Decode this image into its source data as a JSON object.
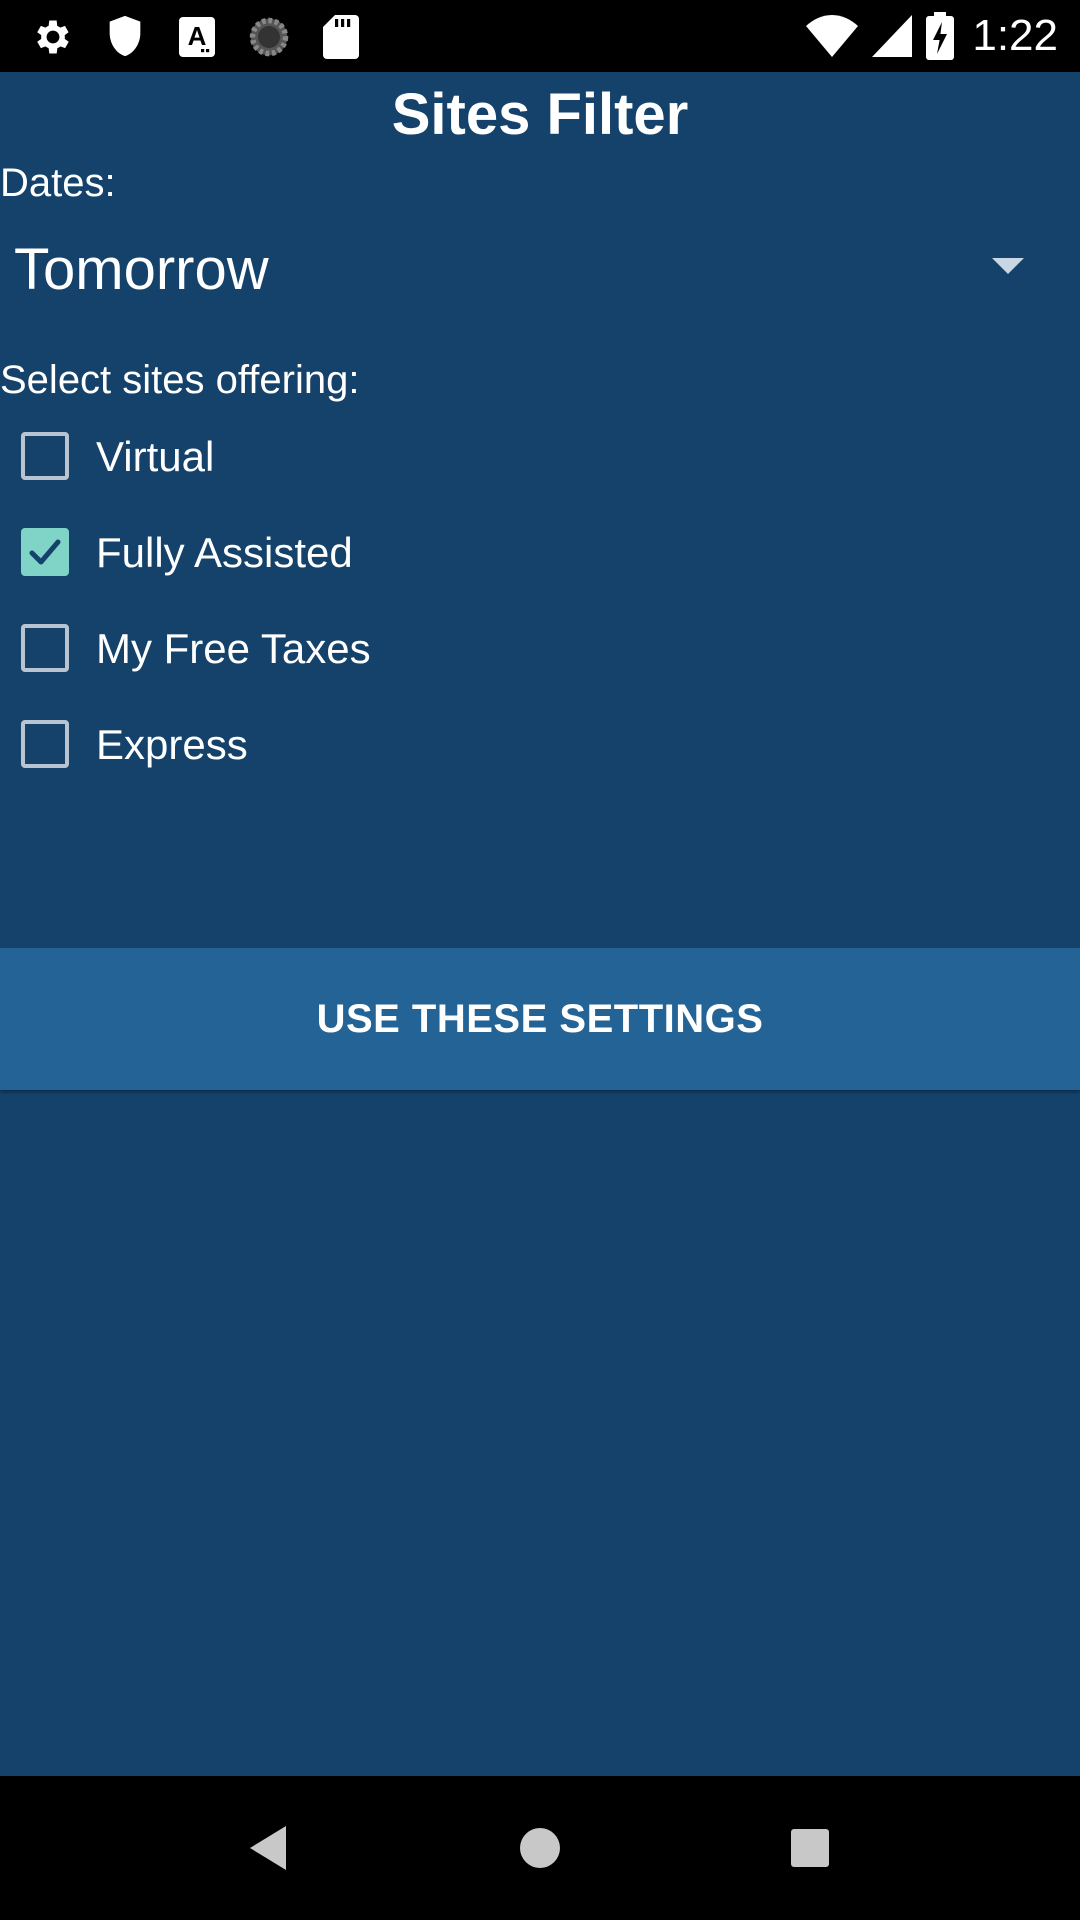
{
  "status_bar": {
    "time": "1:22",
    "icons_left": [
      "gear-icon",
      "shield-icon",
      "font-a-icon",
      "loading-icon",
      "sd-card-icon"
    ],
    "icons_right": [
      "wifi-icon",
      "cell-signal-icon",
      "battery-charging-icon"
    ]
  },
  "page": {
    "title": "Sites Filter"
  },
  "dates": {
    "label": "Dates:",
    "selected": "Tomorrow"
  },
  "sites": {
    "label": "Select sites offering:",
    "options": [
      {
        "label": "Virtual",
        "checked": false
      },
      {
        "label": "Fully Assisted",
        "checked": true
      },
      {
        "label": "My Free Taxes",
        "checked": false
      },
      {
        "label": "Express",
        "checked": false
      }
    ]
  },
  "actions": {
    "use_settings_label": "USE THESE SETTINGS"
  },
  "nav_bar": {
    "buttons": [
      "back-icon",
      "home-icon",
      "recents-icon"
    ]
  },
  "colors": {
    "background": "#14426b",
    "button": "#236396",
    "checkbox_checked": "#7fd3c7",
    "checkbox_border": "#b9c4d0"
  }
}
